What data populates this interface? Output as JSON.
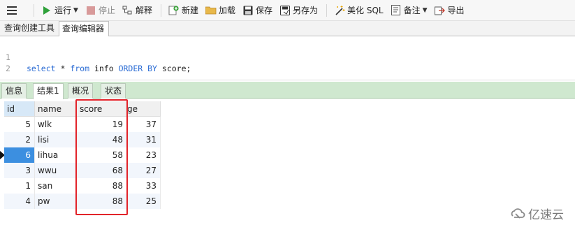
{
  "toolbar": {
    "run_label": "运行",
    "stop_label": "停止",
    "explain_label": "解释",
    "new_label": "新建",
    "load_label": "加载",
    "save_label": "保存",
    "saveas_label": "另存为",
    "beautify_label": "美化 SQL",
    "comment_label": "备注",
    "export_label": "导出"
  },
  "doc_tabs": [
    {
      "label": "查询创建工具"
    },
    {
      "label": "查询编辑器"
    }
  ],
  "editor": {
    "lines": [
      {
        "num": "1",
        "parts": [
          "select",
          " * ",
          "from",
          " info ",
          "ORDER BY",
          " score;"
        ]
      },
      {
        "num": "2"
      }
    ]
  },
  "result_tabs": [
    {
      "label": "信息"
    },
    {
      "label": "结果1"
    },
    {
      "label": "概况"
    },
    {
      "label": "状态"
    }
  ],
  "table": {
    "columns": [
      "id",
      "name",
      "score",
      "ge"
    ],
    "rows": [
      {
        "id": "5",
        "name": "wlk",
        "score": "19",
        "age": "37"
      },
      {
        "id": "2",
        "name": "lisi",
        "score": "48",
        "age": "31"
      },
      {
        "id": "6",
        "name": "lihua",
        "score": "58",
        "age": "23"
      },
      {
        "id": "3",
        "name": "wwu",
        "score": "68",
        "age": "27"
      },
      {
        "id": "1",
        "name": "san",
        "score": "88",
        "age": "33"
      },
      {
        "id": "4",
        "name": "pw",
        "score": "88",
        "age": "25"
      }
    ]
  },
  "watermark": {
    "text": "亿速云"
  },
  "colors": {
    "keyword": "#2b6cd4",
    "result_bar": "#cfe8cf",
    "selection": "#3c8fe0",
    "highlight": "#e2232a"
  }
}
